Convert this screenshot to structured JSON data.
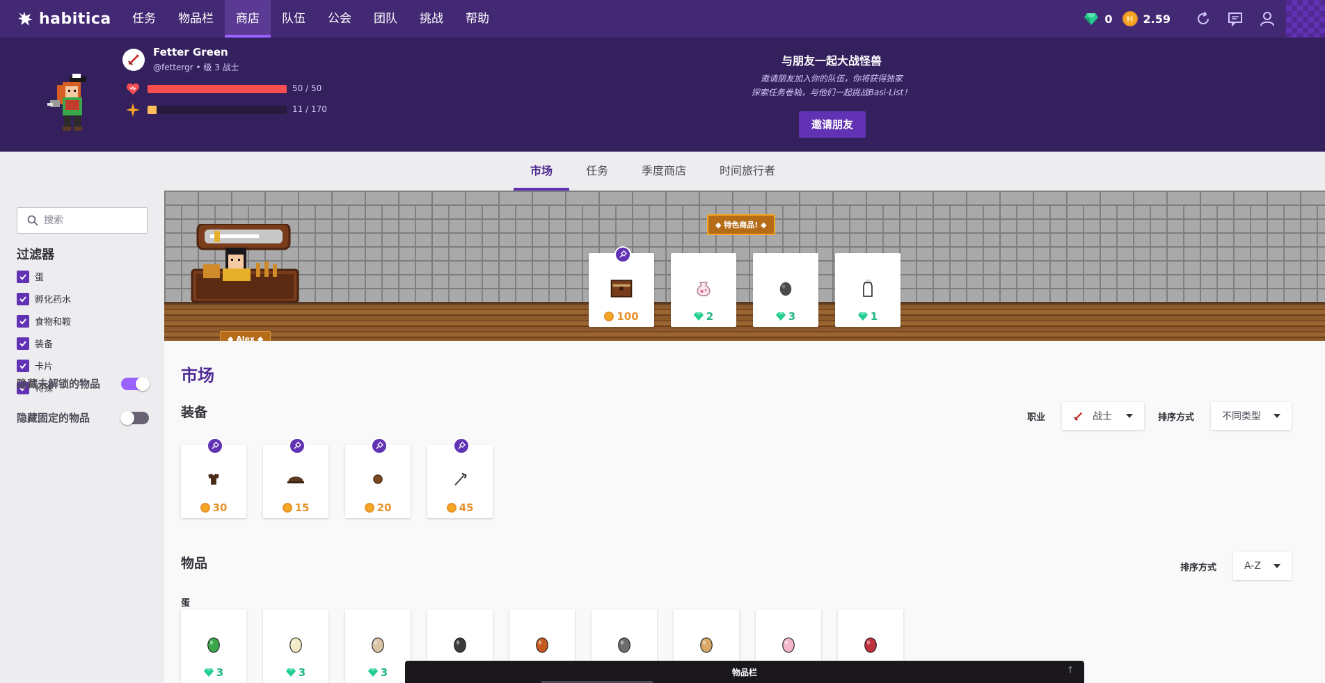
{
  "brand": {
    "name": "habitica"
  },
  "nav": {
    "items": [
      "任务",
      "物品栏",
      "商店",
      "队伍",
      "公会",
      "团队",
      "挑战",
      "帮助"
    ],
    "active_index": 2,
    "gems": "0",
    "gold": "2.59"
  },
  "user": {
    "name": "Fetter Green",
    "subtitle": "@fettergr • 级 3 战士",
    "hp_text": "50 / 50",
    "hp_fraction": 1.0,
    "xp_text": "11 / 170",
    "xp_fraction": 0.065,
    "colors": {
      "hp": "#f74e52",
      "xp": "#ffbe5d"
    }
  },
  "promo": {
    "title": "与朋友一起大战怪兽",
    "line1": "邀请朋友加入你的队伍，你将获得独家",
    "line2": "探索任务卷轴，与他们一起挑战Basi-List！",
    "button": "邀请朋友"
  },
  "subtabs": [
    "市场",
    "任务",
    "季度商店",
    "时间旅行者"
  ],
  "sidebar": {
    "search_placeholder": "搜索",
    "filter_title": "过滤器",
    "filters": [
      "蛋",
      "孵化药水",
      "食物和鞍",
      "装备",
      "卡片",
      "特殊"
    ],
    "toggle_locked": "隐藏未解锁的物品",
    "toggle_pinned": "隐藏固定的物品",
    "toggle_locked_on": true,
    "toggle_pinned_on": false
  },
  "banner": {
    "npc_name": "Alex",
    "featured_label": "特色商品!",
    "featured": [
      {
        "icon": "treasure-chest-icon",
        "price": "100",
        "currency": "gold",
        "pinned": true
      },
      {
        "icon": "potion-sack-icon",
        "price": "2",
        "currency": "gem",
        "pinned": false
      },
      {
        "icon": "dark-egg-icon",
        "price": "3",
        "currency": "gem",
        "pinned": false
      },
      {
        "icon": "milk-bottle-icon",
        "price": "1",
        "currency": "gem",
        "pinned": false
      }
    ]
  },
  "market": {
    "title": "市场",
    "equipment_title": "装备",
    "class_label": "职业",
    "class_value": "战士",
    "sort_label": "排序方式",
    "sort_value": "不同类型",
    "equipment": [
      {
        "icon": "armor-icon",
        "price": "30"
      },
      {
        "icon": "helm-icon",
        "price": "15"
      },
      {
        "icon": "shield-icon",
        "price": "20"
      },
      {
        "icon": "weapon-icon",
        "price": "45"
      }
    ],
    "items_title": "物品",
    "items_sort_label": "排序方式",
    "items_sort_value": "A-Z",
    "eggs_label": "蛋",
    "eggs": [
      {
        "icon": "cactus-egg-icon",
        "price": "3",
        "color": "#3aa84a"
      },
      {
        "icon": "cream-egg-icon",
        "price": "3",
        "color": "#f3ebc4"
      },
      {
        "icon": "spotted-egg-icon",
        "price": "3",
        "color": "#d9c3a4"
      },
      {
        "icon": "panda-egg-icon",
        "price": "",
        "color": "#3b3b3b"
      },
      {
        "icon": "fox-egg-icon",
        "price": "",
        "color": "#c65a1e"
      },
      {
        "icon": "wolf-egg-icon",
        "price": "",
        "color": "#6d6d6d"
      },
      {
        "icon": "tan-egg-icon",
        "price": "",
        "color": "#d8a866"
      },
      {
        "icon": "pink-egg-icon",
        "price": "",
        "color": "#f3b6cd"
      },
      {
        "icon": "dragon-egg-icon",
        "price": "",
        "color": "#c0313d"
      }
    ]
  },
  "drawer": {
    "label": "物品栏"
  }
}
